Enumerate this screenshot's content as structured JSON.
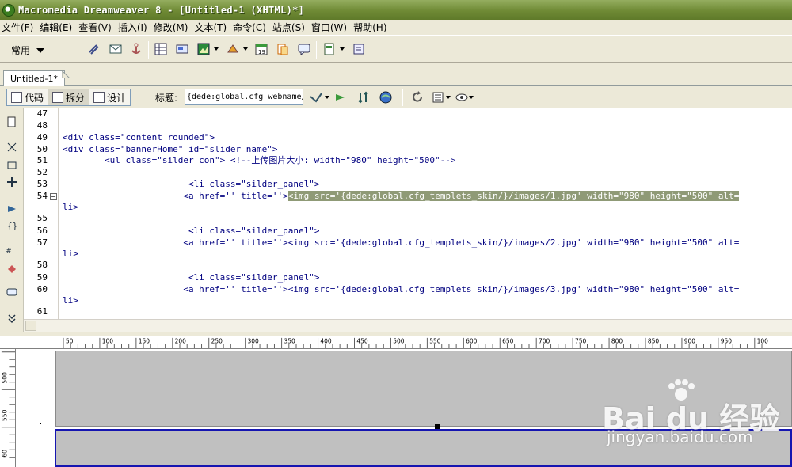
{
  "window": {
    "title": "Macromedia Dreamweaver 8 - [Untitled-1 (XHTML)*]"
  },
  "menu": [
    "文件(F)",
    "编辑(E)",
    "查看(V)",
    "插入(I)",
    "修改(M)",
    "文本(T)",
    "命令(C)",
    "站点(S)",
    "窗口(W)",
    "帮助(H)"
  ],
  "insert_bar": {
    "category": "常用"
  },
  "document": {
    "tab": "Untitled-1*"
  },
  "doc_toolbar": {
    "views": [
      "代码",
      "拆分",
      "设计"
    ],
    "active_view": "拆分",
    "title_label": "标题:",
    "title_value": "{dede:global.cfg_webname/"
  },
  "code": {
    "line_numbers": [
      "47",
      "48",
      "49",
      "50",
      "51",
      "52",
      "53",
      "54",
      "",
      "55",
      "56",
      "57",
      "",
      "58",
      "59",
      "60",
      "",
      "61"
    ],
    "lines": [
      "",
      "",
      "<div class=\"content rounded\">",
      "<div class=\"bannerHome\" id=\"slider_name\">",
      "        <ul class=\"silder_con\"> <!--上传图片大小: width=\"980\" height=\"500\"-->",
      "",
      "                        <li class=\"silder_panel\">",
      "                       <a href='' title=''><img src='{dede:global.cfg_templets_skin/}/images/1.jpg' width=\"980\" height=\"500\" alt=",
      "li>",
      "",
      "                        <li class=\"silder_panel\">",
      "                       <a href='' title=''><img src='{dede:global.cfg_templets_skin/}/images/2.jpg' width=\"980\" height=\"500\" alt=",
      "li>",
      "",
      "                        <li class=\"silder_panel\">",
      "                       <a href='' title=''><img src='{dede:global.cfg_templets_skin/}/images/3.jpg' width=\"980\" height=\"500\" alt=",
      "li>",
      ""
    ],
    "selected_text": "<img src='{dede:global.cfg_templets_skin/}/images/1.jpg' width=\"980\" height=\"500\" alt="
  },
  "ruler": {
    "ticks": [
      "50",
      "100",
      "150",
      "200",
      "250",
      "300",
      "350",
      "400",
      "450",
      "500",
      "550",
      "600",
      "650",
      "700",
      "750",
      "800",
      "850",
      "900",
      "950",
      "100"
    ],
    "vticks": [
      "500",
      "550",
      "60"
    ]
  },
  "watermark": {
    "brand": "Bai du 经验",
    "url": "jingyan.baidu.com"
  }
}
